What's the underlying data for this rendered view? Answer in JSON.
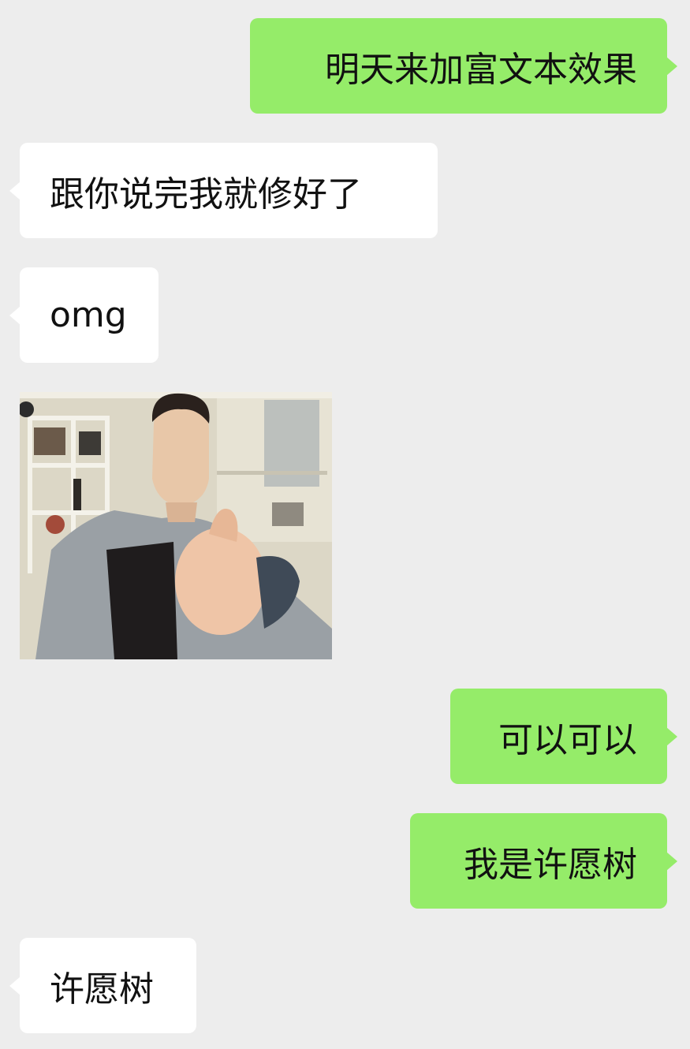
{
  "chat": {
    "messages": [
      {
        "direction": "outgoing",
        "type": "text",
        "text": "明天来加富文本效果"
      },
      {
        "direction": "incoming",
        "type": "text",
        "text": "跟你说完我就修好了"
      },
      {
        "direction": "incoming",
        "type": "text",
        "text": "omg"
      },
      {
        "direction": "incoming",
        "type": "sticker",
        "content": "thumbs-up-man-sticker"
      },
      {
        "direction": "outgoing",
        "type": "text",
        "text": "可以可以"
      },
      {
        "direction": "outgoing",
        "type": "text",
        "text": "我是许愿树"
      },
      {
        "direction": "incoming",
        "type": "text",
        "text": "许愿树"
      }
    ]
  },
  "colors": {
    "background": "#ededed",
    "incoming_bubble": "#ffffff",
    "outgoing_bubble": "#95ec69",
    "text": "#111111"
  }
}
